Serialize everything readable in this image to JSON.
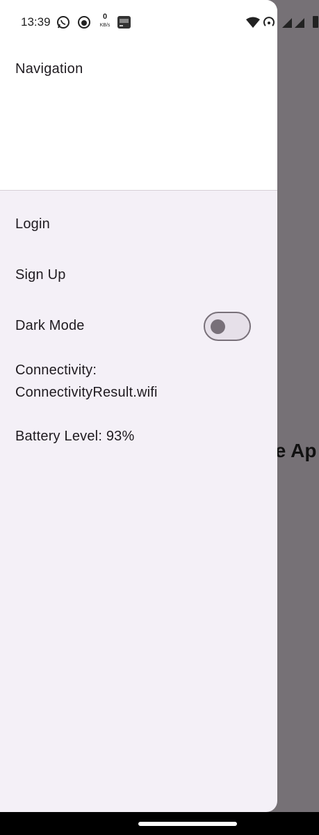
{
  "status_bar": {
    "time": "13:39",
    "net_speed_value": "0",
    "net_speed_unit": "KB/s"
  },
  "background_app": {
    "title_fragment": "le Ap"
  },
  "drawer": {
    "header_title": "Navigation",
    "items": [
      {
        "label": "Login"
      },
      {
        "label": "Sign Up"
      }
    ],
    "dark_mode": {
      "label": "Dark Mode",
      "enabled": false
    },
    "connectivity_label": "Connectivity:",
    "connectivity_value": "ConnectivityResult.wifi",
    "battery_text": "Battery Level: 93%"
  },
  "colors": {
    "drawer_bg": "#f4f0f7",
    "scrim": "#767176",
    "switch_outline": "#787079"
  }
}
